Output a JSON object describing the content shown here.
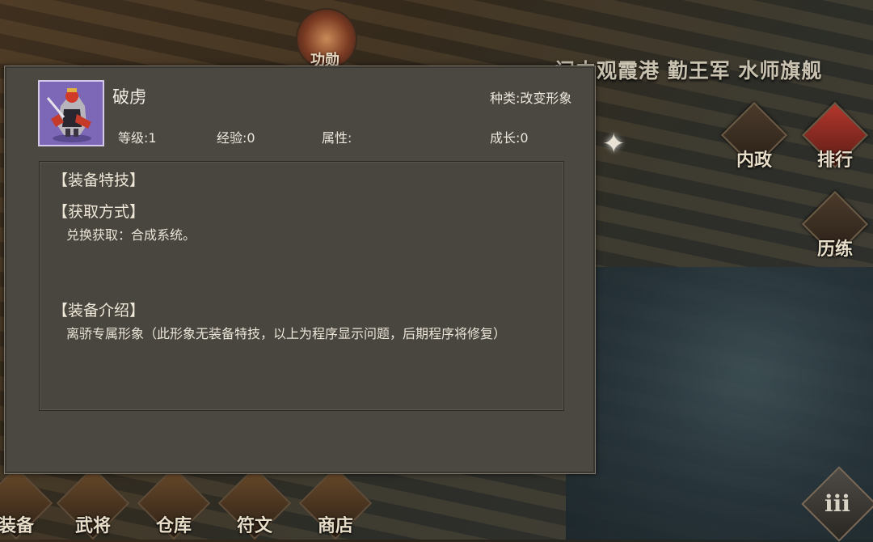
{
  "background": {
    "location_title": "闫中观霞港 勤王军 水师旗舰",
    "top_badge_label": "功勋",
    "side_buttons": [
      {
        "label": "内政",
        "icon": "cross-swords-icon"
      },
      {
        "label": "排行",
        "icon": "scroll-icon"
      },
      {
        "label": "历练",
        "icon": "swords-icon"
      }
    ],
    "bottom_buttons": [
      {
        "label": "装备",
        "icon": "armor-icon"
      },
      {
        "label": "武将",
        "icon": "general-icon"
      },
      {
        "label": "仓库",
        "icon": "warehouse-icon"
      },
      {
        "label": "符文",
        "icon": "rune-icon"
      },
      {
        "label": "商店",
        "icon": "shop-icon"
      }
    ],
    "menu_glyph": "iii"
  },
  "dialog": {
    "item_name": "破虏",
    "type_text": "种类:改变形象",
    "level_text": "等级:1",
    "exp_text": "经验:0",
    "attr_text": "属性:",
    "growth_text": "成长:0",
    "sections": {
      "skill_title": "【装备特技】",
      "obtain_title": "【获取方式】",
      "obtain_body": "兑换获取：合成系统。",
      "intro_title": "【装备介绍】",
      "intro_body": "离骄专属形象（此形象无装备特技，以上为程序显示问题，后期程序将修复）"
    }
  },
  "colors": {
    "dialog_bg": "#4b4741",
    "avatar_bg": "#7d68b8",
    "text": "#ece7dc"
  }
}
